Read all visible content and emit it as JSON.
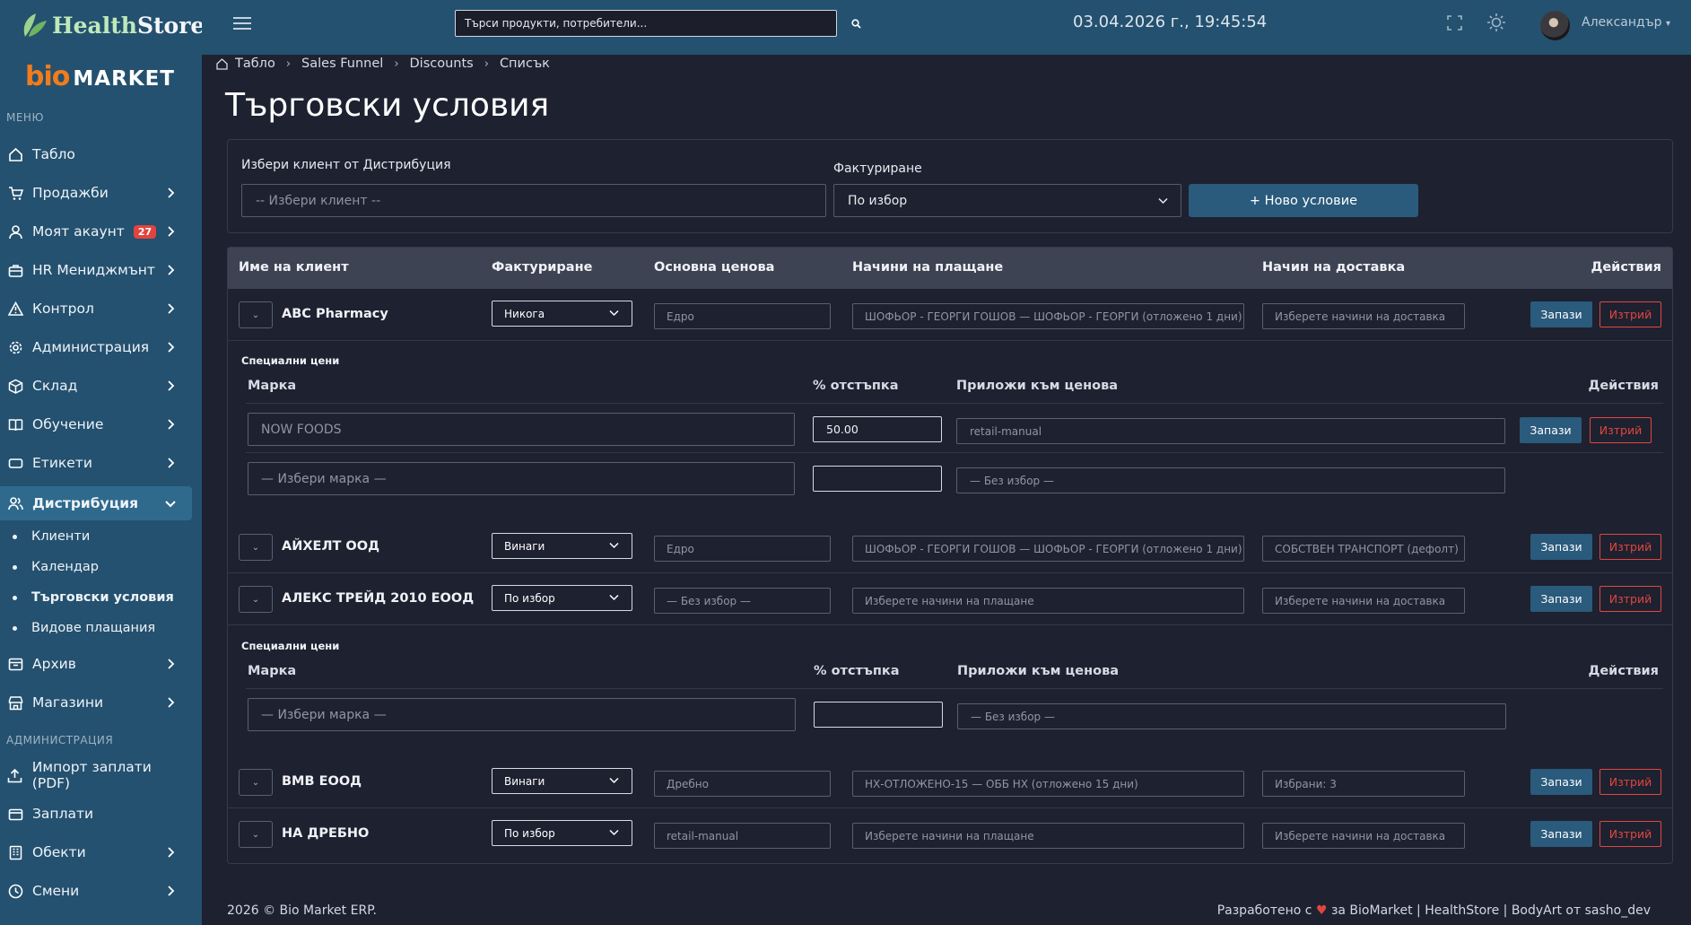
{
  "brand": {
    "name_a": "Health",
    "name_b": "Store",
    "bio": "bio",
    "market": "MARKET"
  },
  "sidebar": {
    "menu_label": "МЕНЮ",
    "admin_label": "АДМИНИСТРАЦИЯ",
    "items": [
      {
        "label": "Табло"
      },
      {
        "label": "Продажби"
      },
      {
        "label": "Моят акаунт",
        "badge": "27"
      },
      {
        "label": "HR Мениджмънт"
      },
      {
        "label": "Контрол"
      },
      {
        "label": "Администрация"
      },
      {
        "label": "Склад"
      },
      {
        "label": "Обучение"
      },
      {
        "label": "Етикети"
      },
      {
        "label": "Дистрибуция"
      },
      {
        "label": "Архив"
      },
      {
        "label": "Магазини"
      },
      {
        "label": "Импорт заплати (PDF)"
      },
      {
        "label": "Заплати"
      },
      {
        "label": "Обекти"
      },
      {
        "label": "Смени"
      }
    ],
    "sub": [
      "Клиенти",
      "Календар",
      "Търговски условия",
      "Видове плащания"
    ]
  },
  "topbar": {
    "search_placeholder": "Търси продукти, потребители...",
    "clock": "03.04.2026 г., 19:45:54",
    "user": "Александър"
  },
  "breadcrumb": {
    "home": "Табло",
    "b1": "Sales Funnel",
    "b2": "Discounts",
    "b3": "Списък"
  },
  "page": {
    "title": "Търговски условия"
  },
  "filter": {
    "client_label": "Избери клиент от Дистрибуция",
    "client_placeholder": "-- Избери клиент --",
    "billing_label": "Фактуриране",
    "billing_value": "По избор",
    "new_button": "+ Ново условие"
  },
  "table": {
    "headers": {
      "name": "Име на клиент",
      "billing": "Фактуриране",
      "price": "Основна ценова",
      "payment": "Начини на плащане",
      "delivery": "Начин на доставка",
      "actions": "Действия"
    },
    "save": "Запази",
    "delete": "Изтрий",
    "rows": [
      {
        "name": "ABC Pharmacy",
        "billing": "Никога",
        "price": "Едро",
        "payment": "ШОФЬОР - ГЕОРГИ ГОШОВ — ШОФЬОР - ГЕОРГИ (отложено 1 дни)",
        "delivery": "Изберете начини на доставка"
      },
      {
        "name": "АЙХЕЛТ ООД",
        "billing": "Винаги",
        "price": "Едро",
        "payment": "ШОФЬОР - ГЕОРГИ ГОШОВ — ШОФЬОР - ГЕОРГИ (отложено 1 дни)",
        "delivery": "СОБСТВЕН ТРАНСПОРТ (дефолт)"
      },
      {
        "name": "АЛЕКС ТРЕЙД 2010 ЕООД",
        "billing": "По избор",
        "price": "— Без избор —",
        "payment": "Изберете начини на плащане",
        "delivery": "Изберете начини на доставка"
      },
      {
        "name": "BMB ЕООД",
        "billing": "Винаги",
        "price": "Дребно",
        "payment": "НХ-ОТЛОЖЕНО-15 — ОББ НХ (отложено 15 дни)",
        "delivery": "Избрани: 3"
      },
      {
        "name": "НА ДРЕБНО",
        "billing": "По избор",
        "price": "retail-manual",
        "payment": "Изберете начини на плащане",
        "delivery": "Изберете начини на доставка"
      }
    ],
    "special": {
      "title": "Специални цени",
      "brand": "Марка",
      "discount": "% отстъпка",
      "apply": "Приложи към ценова",
      "actions": "Действия",
      "brand_placeholder": "— Избери марка —",
      "apply_placeholder": "— Без избор —",
      "row1": {
        "brand": "NOW FOODS",
        "discount": "50.00",
        "apply": "retail-manual"
      }
    }
  },
  "footer": {
    "left": "2026 © Bio Market ERP.",
    "right_a": "Разработено с",
    "right_b": "за BioMarket | HealthStore | BodyArt от sasho_dev"
  }
}
